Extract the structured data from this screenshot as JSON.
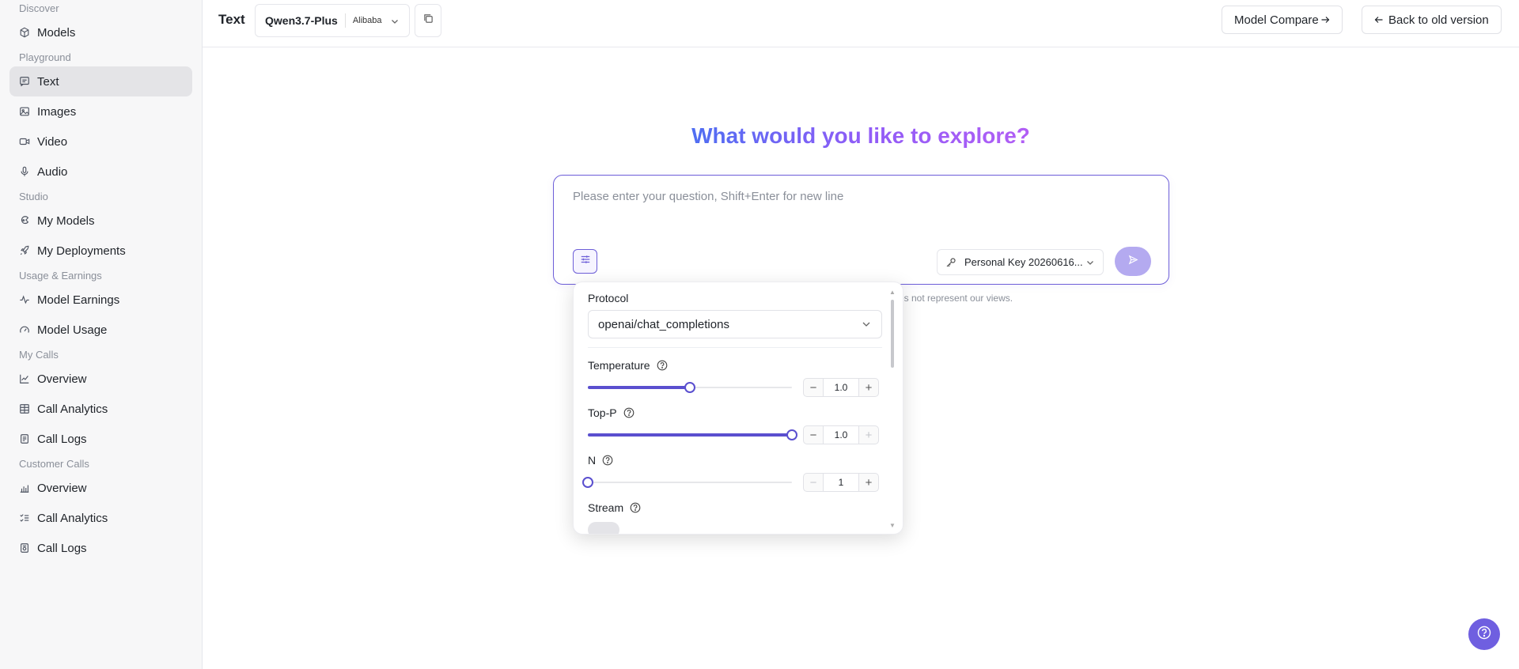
{
  "sidebar": {
    "sections": [
      {
        "title": "Discover",
        "items": [
          {
            "label": "Models",
            "icon": "cube-icon"
          }
        ]
      },
      {
        "title": "Playground",
        "items": [
          {
            "label": "Text",
            "icon": "chat-icon",
            "active": true
          },
          {
            "label": "Images",
            "icon": "image-icon"
          },
          {
            "label": "Video",
            "icon": "video-icon"
          },
          {
            "label": "Audio",
            "icon": "mic-icon"
          }
        ]
      },
      {
        "title": "Studio",
        "items": [
          {
            "label": "My Models",
            "icon": "brain-icon"
          },
          {
            "label": "My Deployments",
            "icon": "rocket-icon"
          }
        ]
      },
      {
        "title": "Usage & Earnings",
        "items": [
          {
            "label": "Model Earnings",
            "icon": "activity-icon"
          },
          {
            "label": "Model Usage",
            "icon": "gauge-icon"
          }
        ]
      },
      {
        "title": "My Calls",
        "items": [
          {
            "label": "Overview",
            "icon": "line-chart-icon"
          },
          {
            "label": "Call Analytics",
            "icon": "table-icon"
          },
          {
            "label": "Call Logs",
            "icon": "logs-icon"
          }
        ]
      },
      {
        "title": "Customer Calls",
        "items": [
          {
            "label": "Overview",
            "icon": "bar-chart-icon"
          },
          {
            "label": "Call Analytics",
            "icon": "checklist-icon"
          },
          {
            "label": "Call Logs",
            "icon": "logs-icon"
          }
        ]
      }
    ]
  },
  "header": {
    "title": "Text",
    "model_name": "Qwen3.7-Plus",
    "provider": "Alibaba",
    "compare_label": "Model Compare",
    "back_label": "Back to old version"
  },
  "main": {
    "hero": "What would you like to explore?",
    "input_placeholder": "Please enter your question, Shift+Enter for new line",
    "key_label": "Personal Key 20260616...",
    "disclaimer": "es not represent our views."
  },
  "params": {
    "protocol_label": "Protocol",
    "protocol_value": "openai/chat_completions",
    "temperature": {
      "label": "Temperature",
      "value": "1.0",
      "fraction": 0.5
    },
    "top_p": {
      "label": "Top-P",
      "value": "1.0",
      "fraction": 1.0
    },
    "n": {
      "label": "N",
      "value": "1",
      "fraction": 0.0
    },
    "stream_label": "Stream"
  },
  "colors": {
    "accent": "#5a4fcf",
    "send_button": "#b4aaf0",
    "fab": "#6f5fe0"
  }
}
